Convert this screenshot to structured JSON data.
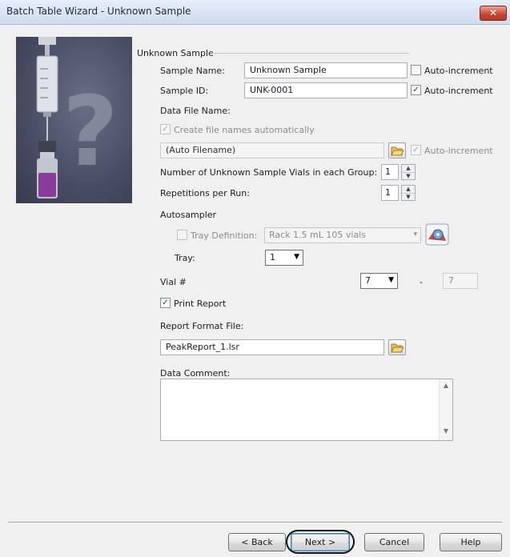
{
  "window": {
    "title": "Batch Table Wizard - Unknown Sample",
    "close_label": "✕"
  },
  "group": {
    "label": "Unknown Sample"
  },
  "sample_name": {
    "label": "Sample Name:",
    "value": "Unknown Sample",
    "auto_increment_label": "Auto-increment",
    "auto_increment_checked": false
  },
  "sample_id": {
    "label": "Sample ID:",
    "value": "UNK-0001",
    "auto_increment_label": "Auto-increment",
    "auto_increment_checked": true
  },
  "data_file": {
    "label": "Data File Name:",
    "create_auto_label": "Create file names automatically",
    "create_auto_checked": true,
    "value": "(Auto Filename)",
    "auto_increment_label": "Auto-increment",
    "auto_increment_checked": true
  },
  "vials_per_group": {
    "label": "Number of Unknown Sample Vials in each Group:",
    "value": "1"
  },
  "repetitions": {
    "label": "Repetitions per Run:",
    "value": "1"
  },
  "autosampler": {
    "label": "Autosampler",
    "tray_definition_label": "Tray Definition:",
    "tray_definition_checked": false,
    "tray_definition_value": "Rack 1.5 mL 105 vials",
    "tray_label": "Tray:",
    "tray_value": "1"
  },
  "vial": {
    "label": "Vial #",
    "from_value": "7",
    "dash": "-",
    "to_value": "7"
  },
  "print_report": {
    "label": "Print Report",
    "checked": true
  },
  "report_format": {
    "label": "Report Format File:",
    "value": "PeakReport_1.lsr"
  },
  "data_comment": {
    "label": "Data Comment:",
    "value": ""
  },
  "buttons": {
    "back": "< Back",
    "next": "Next >",
    "cancel": "Cancel",
    "help": "Help"
  },
  "colors": {
    "accent": "#3c7fb1",
    "titlebar": "#dbe6f4",
    "close": "#c7452f",
    "panel": "#4a4f66"
  },
  "icons": [
    "syringe-icon",
    "vial-icon",
    "question-mark-icon",
    "folder-open-icon",
    "tray-config-icon",
    "close-icon"
  ]
}
